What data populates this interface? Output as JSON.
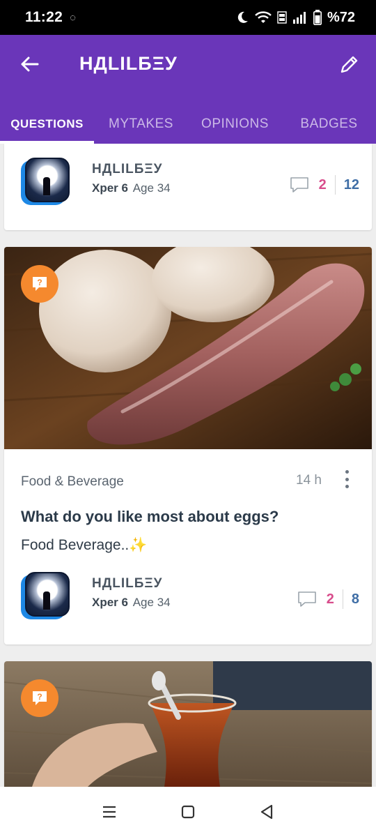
{
  "status_bar": {
    "time": "11:22",
    "sync_glyph": "◌",
    "battery": "%72"
  },
  "header": {
    "title": "НДLІLБΞУ",
    "tabs": [
      {
        "label": "QUESTIONS",
        "active": true
      },
      {
        "label": "MYTAKES",
        "active": false
      },
      {
        "label": "OPINIONS",
        "active": false
      },
      {
        "label": "BADGES",
        "active": false
      }
    ]
  },
  "posts": [
    {
      "author": {
        "name": "НДLІLБΞУ",
        "xp": "Xper 6",
        "age": "Age 34"
      },
      "opinions": "2",
      "views": "12"
    },
    {
      "image": "sausage-and-eggs-photo",
      "category": "Food & Beverage",
      "time_ago": "14 h",
      "title": "What do you like most about eggs?",
      "body": "Food Beverage..✨",
      "author": {
        "name": "НДLІLБΞУ",
        "xp": "Xper 6",
        "age": "Age 34"
      },
      "opinions": "2",
      "views": "8"
    },
    {
      "image": "tea-glass-photo"
    }
  ],
  "colors": {
    "brand_purple": "#6a36b9",
    "opinions_pink": "#d84d8c",
    "views_blue": "#3f6ea6",
    "question_badge_orange": "#f5892e"
  }
}
